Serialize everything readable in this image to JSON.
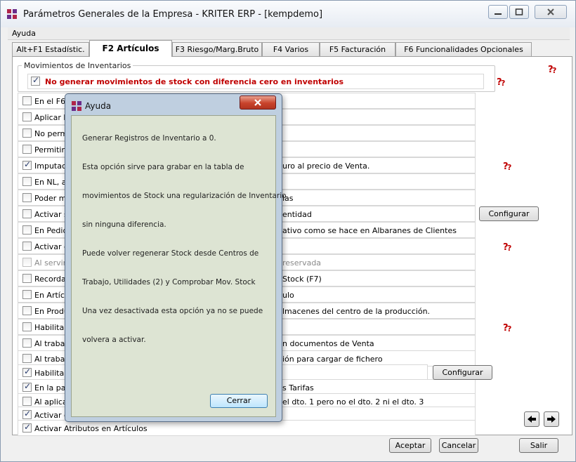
{
  "window": {
    "title": "Parámetros Generales de la Empresa - KRITER ERP - [kempdemo]"
  },
  "menu": {
    "help": "Ayuda"
  },
  "tabs": [
    {
      "label": "Alt+F1 Estadístic."
    },
    {
      "label": "F2 Artículos"
    },
    {
      "label": "F3 Riesgo/Marg.Bruto"
    },
    {
      "label": "F4 Varios"
    },
    {
      "label": "F5 Facturación"
    },
    {
      "label": "F6 Funcionalidades Opcionales"
    }
  ],
  "inventory_group": {
    "title": "Movimientos de Inventarios",
    "option": "No generar movimientos de stock con diferencia cero en inventarios"
  },
  "rows": [
    {
      "left": "En el F6",
      "right": ""
    },
    {
      "left": "Aplicar la",
      "right": ""
    },
    {
      "left": "No permi",
      "right": ""
    },
    {
      "left": "Permitir re",
      "right": ""
    },
    {
      "left": "Imputacio",
      "right": "uro al precio de Venta."
    },
    {
      "left": "En NL, a",
      "right": ""
    },
    {
      "left": "Poder ma",
      "right": "las"
    },
    {
      "left": "Activar se",
      "right": "entidad"
    },
    {
      "left": "En Pedid",
      "right": "ativo como se hace en Albaranes de Clientes"
    },
    {
      "left": "Activar c",
      "right": ""
    },
    {
      "left": "Al servir p",
      "right": "reservada"
    },
    {
      "left": "Recorda",
      "right": "Stock (F7)"
    },
    {
      "left": "En Artícu",
      "right": "ulo"
    },
    {
      "left": "En Produ",
      "right": "lmacenes del centro de la producción."
    },
    {
      "left": "Habilitar",
      "right": ""
    },
    {
      "left": "Al trabaja",
      "right": "n documentos de Venta"
    },
    {
      "left": "Al trabaja",
      "right": "ión para cargar de fichero"
    },
    {
      "left": "Habilitar c",
      "right": ""
    },
    {
      "left": "En la par",
      "right": "s Tarifas"
    },
    {
      "left": "Al aplicar",
      "right": "el dto. 1 pero no el dto. 2 ni el dto. 3"
    },
    {
      "left": "Activar c",
      "right": ""
    },
    {
      "left": "Activar Atributos en Artículos",
      "right": ""
    }
  ],
  "buttons": {
    "configure": "Configurar",
    "accept": "Aceptar",
    "cancel": "Cancelar",
    "exit": "Salir"
  },
  "help_dialog": {
    "title": "Ayuda",
    "lines": [
      "Generar Registros de Inventario a 0.",
      "Esta opción sirve para grabar en la tabla de",
      "movimientos de Stock una regularización de Inventario",
      "sin ninguna diferencia.",
      "Puede volver regenerar Stock desde Centros de",
      "Trabajo, Utilidades (2) y Comprobar Mov. Stock",
      "Una vez desactivada esta opción ya no se puede",
      "volvera a activar."
    ],
    "close_button": "Cerrar"
  }
}
